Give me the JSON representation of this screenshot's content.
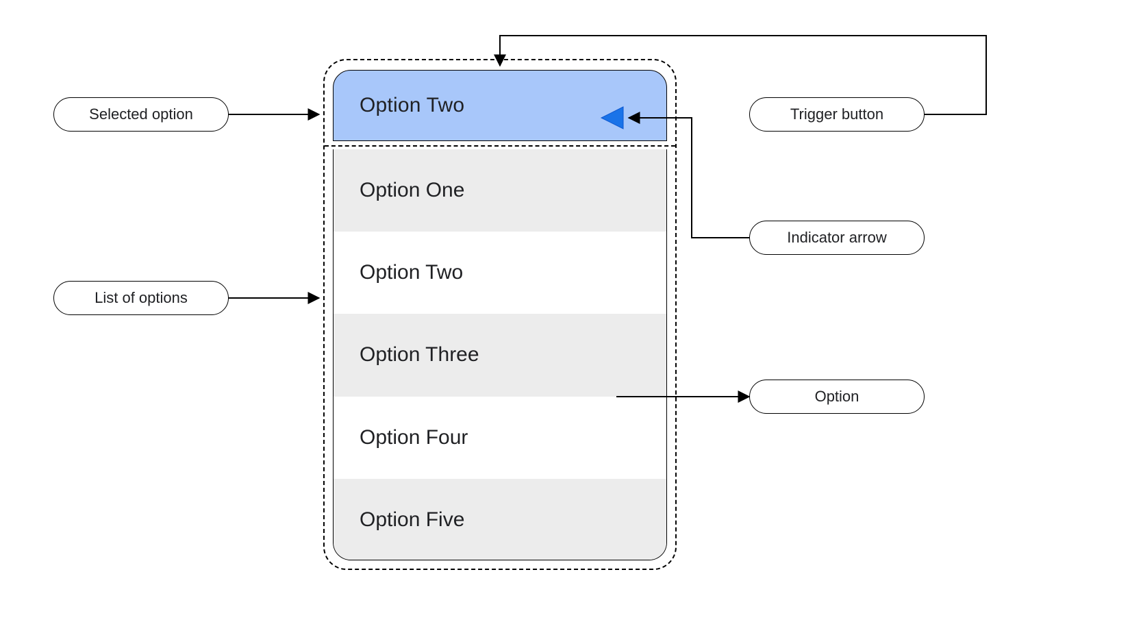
{
  "dropdown": {
    "selected_label": "Option Two",
    "options": [
      "Option One",
      "Option Two",
      "Option Three",
      "Option  Four",
      "Option Five"
    ]
  },
  "callouts": {
    "selected_option": "Selected option",
    "list_of_options": "List of options",
    "trigger_button": "Trigger button",
    "indicator_arrow": "Indicator arrow",
    "option": "Option"
  },
  "colors": {
    "trigger_fill": "#a8c7fa",
    "arrow_fill": "#1a73e8",
    "stripe": "#ececec"
  }
}
